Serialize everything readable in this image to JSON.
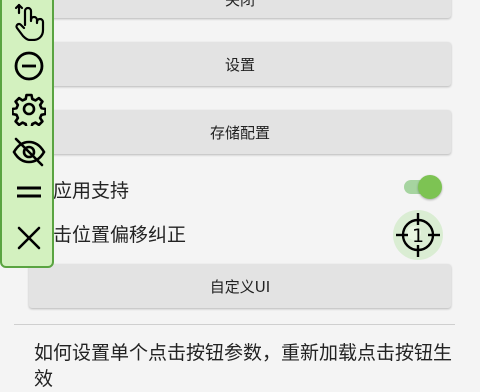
{
  "buttons": {
    "top_label": "关闭",
    "settings_label": "设置",
    "save_config_label": "存储配置",
    "custom_ui_label": "自定义UI"
  },
  "options": {
    "cross_app_label": "跨应用支持",
    "cross_app_enabled": true,
    "offset_label": "点击位置偏移纠正",
    "target_number": "1"
  },
  "help": {
    "text": "如何设置单个点击按钮参数，重新加载点击按钮生效"
  },
  "toolbar": {
    "items": [
      "touch-icon",
      "minus-circle-icon",
      "gear-icon",
      "eye-off-icon",
      "drag-handle-icon",
      "close-icon"
    ]
  },
  "colors": {
    "toolbar_bg": "#d3f1bf",
    "toolbar_border": "#5aa441",
    "switch_on": "#7dc353",
    "button_bg": "#e3e3e3"
  }
}
